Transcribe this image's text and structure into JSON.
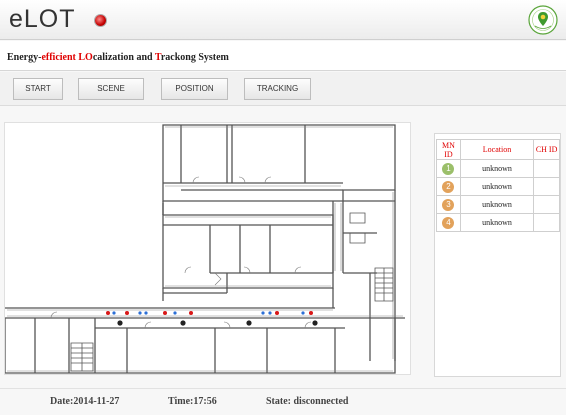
{
  "header": {
    "title": "eLOT"
  },
  "subtitle": {
    "part1": "Energy-",
    "part2": "efficient ",
    "part3": "LO",
    "part4": "calization and ",
    "part5": "T",
    "part6": "rackong System"
  },
  "toolbar": {
    "start": "START",
    "scene": "SCENE",
    "position": "POSITION",
    "tracking": "TRACKING"
  },
  "table": {
    "headers": [
      "MN ID",
      "Location",
      "CH ID"
    ],
    "rows": [
      {
        "id": "1",
        "location": "unknown",
        "ch": "",
        "color": "#9bbf6a"
      },
      {
        "id": "2",
        "location": "unknown",
        "ch": "",
        "color": "#e2a25b"
      },
      {
        "id": "3",
        "location": "unknown",
        "ch": "",
        "color": "#e2a25b"
      },
      {
        "id": "4",
        "location": "unknown",
        "ch": "",
        "color": "#e2a25b"
      }
    ]
  },
  "footer": {
    "date": "Date:2014-11-27",
    "time": "Time:17:56",
    "state": "State: disconnected"
  },
  "colors": {
    "accent_red": "#e00000",
    "node_red": "#d81818",
    "node_blue": "#2c6fd6"
  }
}
